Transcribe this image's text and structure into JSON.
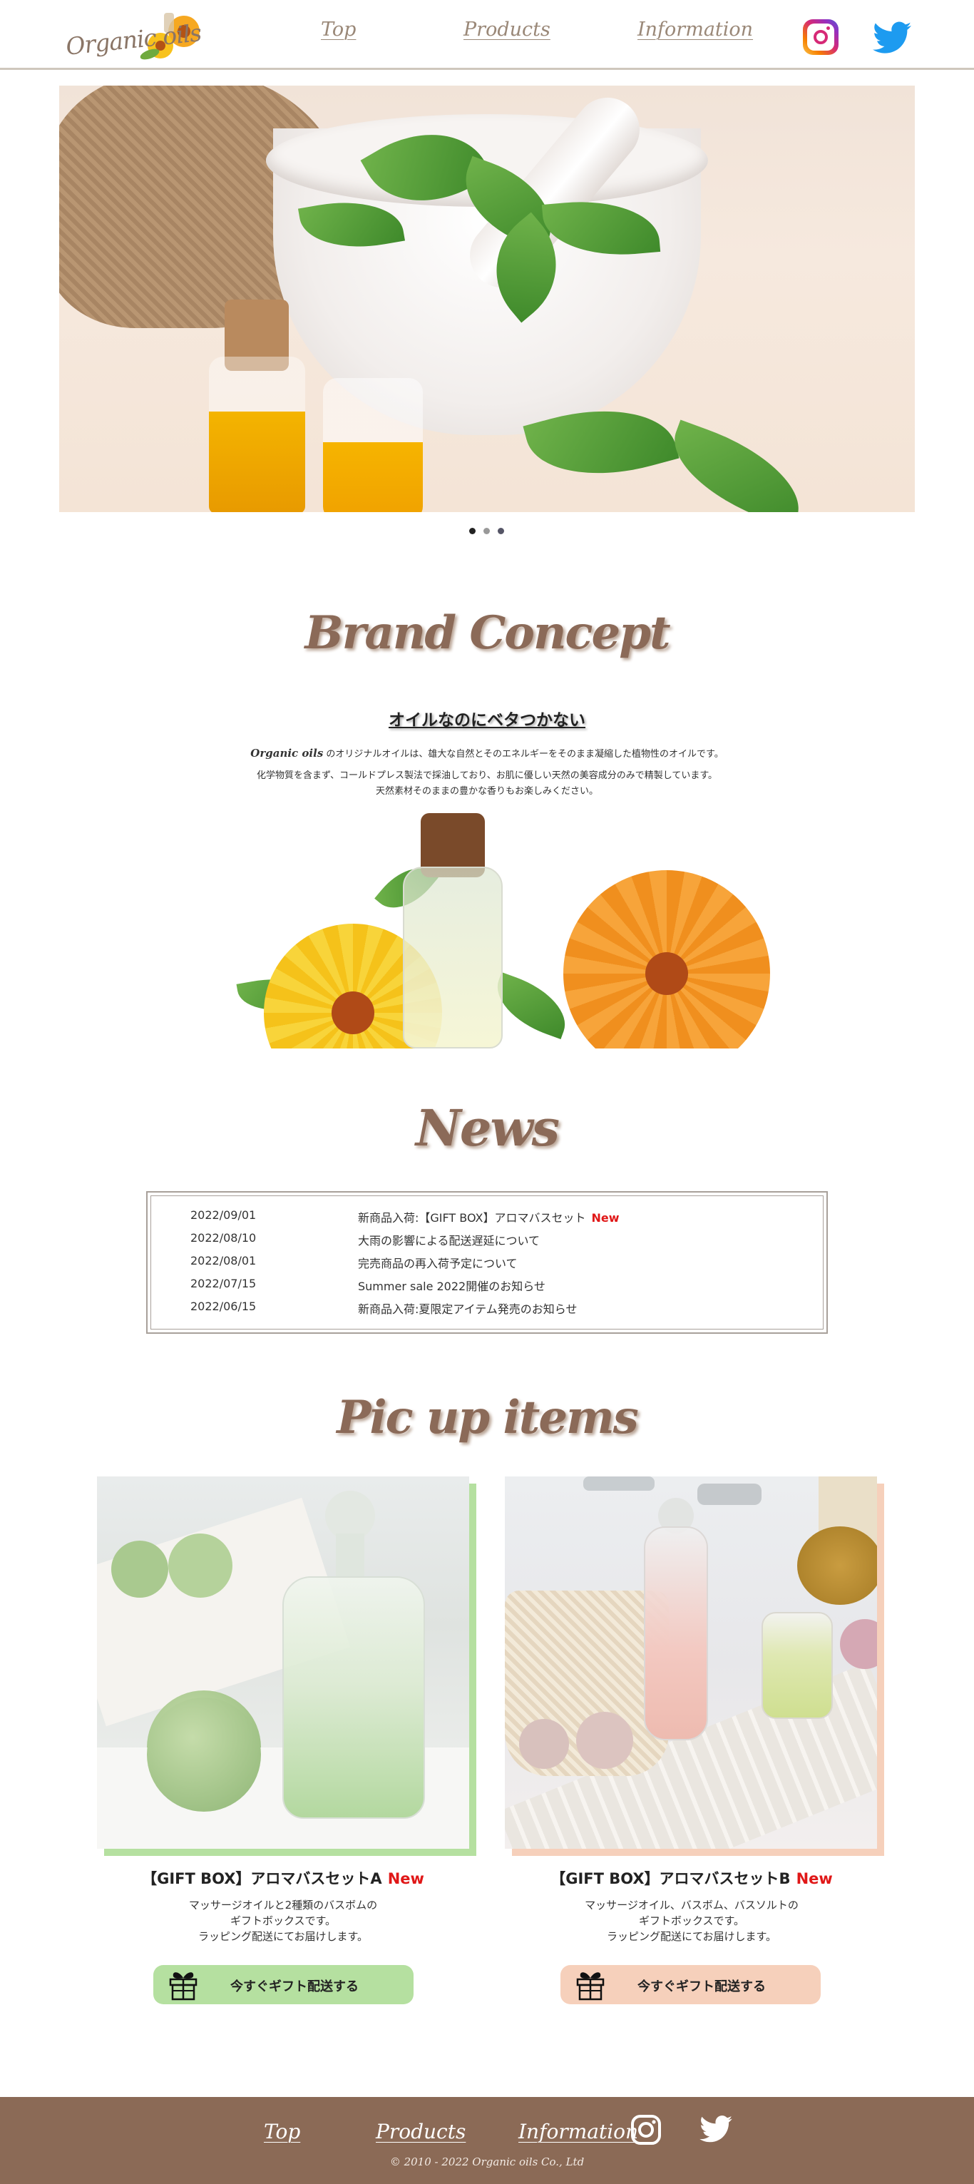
{
  "header": {
    "logo_text": "Organic oils",
    "nav": [
      "Top",
      "Products",
      "Information"
    ]
  },
  "icons": {
    "instagram": "instagram-icon",
    "twitter": "twitter-icon",
    "gift": "gift-box-icon"
  },
  "colors": {
    "brand_brown": "#8b6a56",
    "accent_green": "#b5e0a0",
    "accent_peach": "#f6d0bb",
    "new_red": "#e01818"
  },
  "carousel": {
    "slide_count": 3,
    "active_index": 0
  },
  "concept": {
    "title": "Brand Concept",
    "heading": "オイルなのにベタつかない",
    "brand": "Organic oils",
    "line1": " のオリジナルオイルは、雄大な自然とそのエネルギーをそのまま凝縮した植物性のオイルです。",
    "line2": "化学物質を含まず、コールドプレス製法で採油しており、お肌に優しい天然の美容成分のみで精製しています。",
    "line3": "天然素材そのままの豊かな香りもお楽しみください。"
  },
  "news": {
    "title": "News",
    "items": [
      {
        "date": "2022/09/01",
        "title": "新商品入荷:【GIFT BOX】アロマバスセット",
        "new": "New"
      },
      {
        "date": "2022/08/10",
        "title": "大雨の影響による配送遅延について",
        "new": ""
      },
      {
        "date": "2022/08/01",
        "title": "完売商品の再入荷予定について",
        "new": ""
      },
      {
        "date": "2022/07/15",
        "title": "Summer sale 2022開催のお知らせ",
        "new": ""
      },
      {
        "date": "2022/06/15",
        "title": "新商品入荷:夏限定アイテム発売のお知らせ",
        "new": ""
      }
    ]
  },
  "pickup": {
    "title": "Pic up items",
    "items": [
      {
        "title": "【GIFT BOX】アロマバスセットA",
        "new": "New",
        "desc": [
          "マッサージオイルと2種類のバスボムの",
          "ギフトボックスです。",
          "ラッピング配送にてお届けします。"
        ],
        "button": "今すぐギフト配送する"
      },
      {
        "title": "【GIFT BOX】アロマバスセットB",
        "new": "New",
        "desc": [
          "マッサージオイル、バスボム、バスソルトの",
          "ギフトボックスです。",
          "ラッピング配送にてお届けします。"
        ],
        "button": "今すぐギフト配送する"
      }
    ]
  },
  "footer": {
    "nav": [
      "Top",
      "Products",
      "Information"
    ],
    "copyright": "© 2010 - 2022 Organic oils Co., Ltd"
  }
}
